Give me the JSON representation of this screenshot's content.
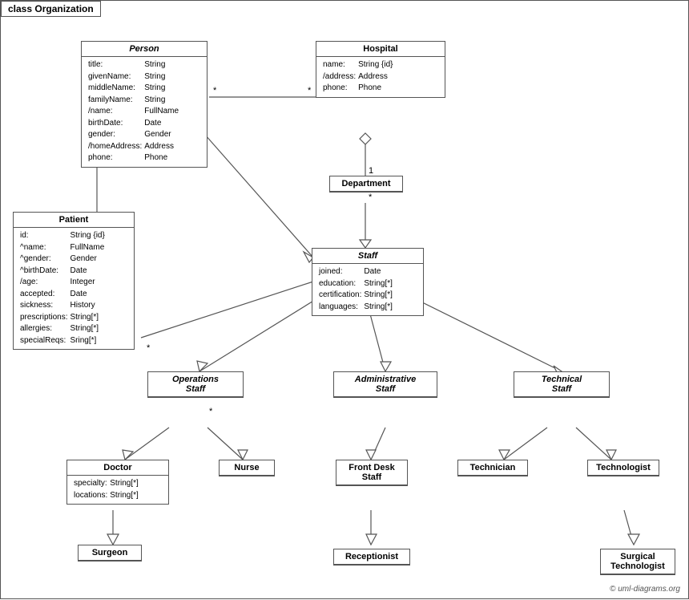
{
  "title": "class Organization",
  "classes": {
    "person": {
      "name": "Person",
      "italic": true,
      "attributes": [
        [
          "title:",
          "String"
        ],
        [
          "givenName:",
          "String"
        ],
        [
          "middleName:",
          "String"
        ],
        [
          "familyName:",
          "String"
        ],
        [
          "/name:",
          "FullName"
        ],
        [
          "birthDate:",
          "Date"
        ],
        [
          "gender:",
          "Gender"
        ],
        [
          "/homeAddress:",
          "Address"
        ],
        [
          "phone:",
          "Phone"
        ]
      ]
    },
    "hospital": {
      "name": "Hospital",
      "italic": false,
      "attributes": [
        [
          "name:",
          "String {id}"
        ],
        [
          "/address:",
          "Address"
        ],
        [
          "phone:",
          "Phone"
        ]
      ]
    },
    "department": {
      "name": "Department",
      "italic": false,
      "attributes": []
    },
    "staff": {
      "name": "Staff",
      "italic": true,
      "attributes": [
        [
          "joined:",
          "Date"
        ],
        [
          "education:",
          "String[*]"
        ],
        [
          "certification:",
          "String[*]"
        ],
        [
          "languages:",
          "String[*]"
        ]
      ]
    },
    "patient": {
      "name": "Patient",
      "italic": false,
      "attributes": [
        [
          "id:",
          "String {id}"
        ],
        [
          "^name:",
          "FullName"
        ],
        [
          "^gender:",
          "Gender"
        ],
        [
          "^birthDate:",
          "Date"
        ],
        [
          "/age:",
          "Integer"
        ],
        [
          "accepted:",
          "Date"
        ],
        [
          "sickness:",
          "History"
        ],
        [
          "prescriptions:",
          "String[*]"
        ],
        [
          "allergies:",
          "String[*]"
        ],
        [
          "specialReqs:",
          "Sring[*]"
        ]
      ]
    },
    "operations_staff": {
      "name": "Operations Staff",
      "italic": true
    },
    "administrative_staff": {
      "name": "Administrative Staff",
      "italic": true
    },
    "technical_staff": {
      "name": "Technical Staff",
      "italic": true
    },
    "doctor": {
      "name": "Doctor",
      "italic": false,
      "attributes": [
        [
          "specialty:",
          "String[*]"
        ],
        [
          "locations:",
          "String[*]"
        ]
      ]
    },
    "nurse": {
      "name": "Nurse",
      "italic": false,
      "attributes": []
    },
    "front_desk_staff": {
      "name": "Front Desk Staff",
      "italic": false,
      "attributes": []
    },
    "technician": {
      "name": "Technician",
      "italic": false,
      "attributes": []
    },
    "technologist": {
      "name": "Technologist",
      "italic": false,
      "attributes": []
    },
    "surgeon": {
      "name": "Surgeon",
      "italic": false,
      "attributes": []
    },
    "receptionist": {
      "name": "Receptionist",
      "italic": false,
      "attributes": []
    },
    "surgical_technologist": {
      "name": "Surgical Technologist",
      "italic": false,
      "attributes": []
    }
  },
  "copyright": "© uml-diagrams.org"
}
